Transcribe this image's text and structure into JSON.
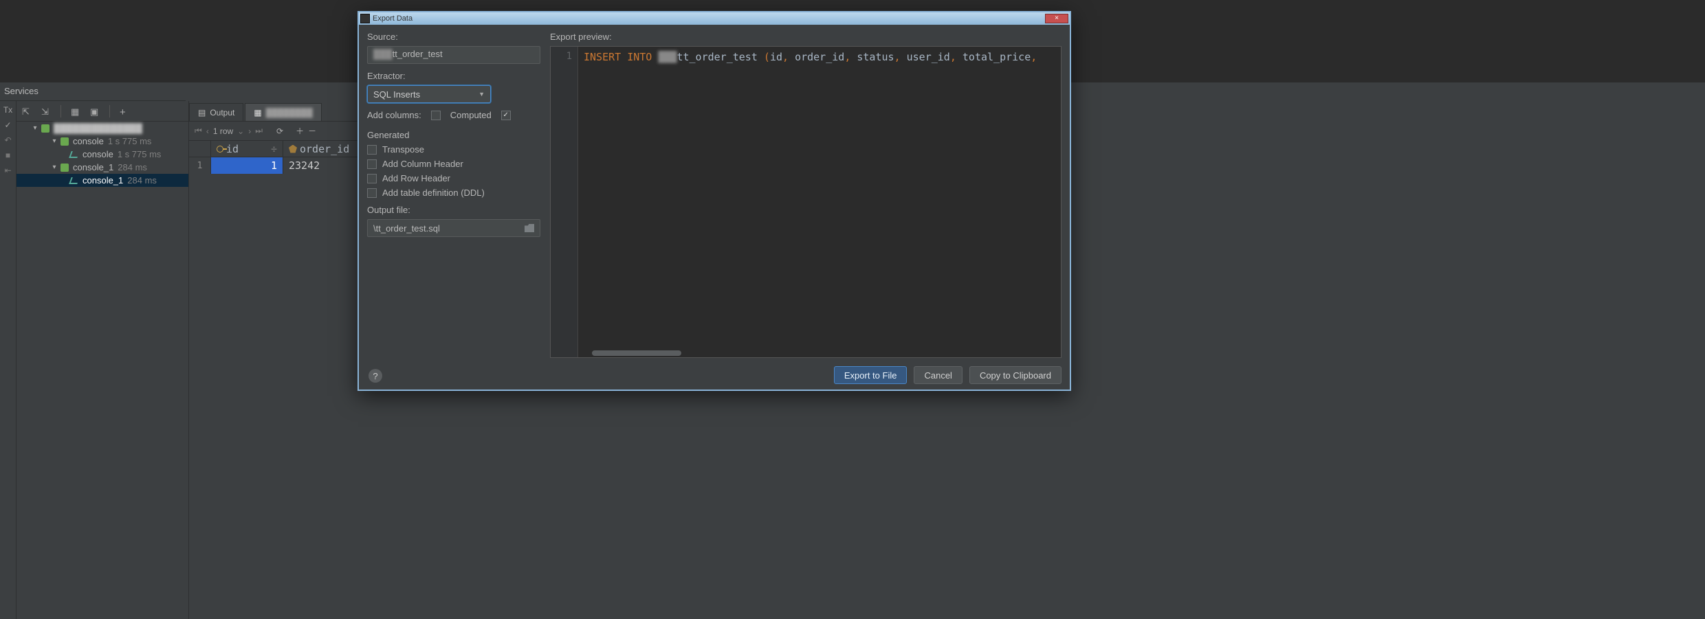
{
  "services": {
    "panel_title": "Services",
    "gutter": {
      "tx": "Tx"
    },
    "tree": {
      "root_label": "",
      "items": [
        {
          "label": "console",
          "time": "1 s 775 ms",
          "depth": 2
        },
        {
          "label": "console",
          "time": "1 s 775 ms",
          "depth": 3
        },
        {
          "label": "console_1",
          "time": "284 ms",
          "depth": 2
        },
        {
          "label": "console_1",
          "time": "284 ms",
          "depth": 3,
          "selected": true
        }
      ]
    }
  },
  "datapane": {
    "tab_output": "Output",
    "tab_table": "",
    "rowcount": "1 row",
    "columns": {
      "c1": "id",
      "c2": "order_id",
      "sort": "÷"
    },
    "rows": [
      {
        "num": "1",
        "c1": "1",
        "c2": "23242"
      }
    ]
  },
  "dialog": {
    "title": "Export Data",
    "source_label": "Source:",
    "source_value": "tt_order_test",
    "extractor_label": "Extractor:",
    "extractor_value": "SQL Inserts",
    "addcols_label": "Add columns:",
    "computed_label": "Computed",
    "generated_label": "Generated",
    "transpose_label": "Transpose",
    "addcolheader_label": "Add Column Header",
    "addrowheader_label": "Add Row Header",
    "addddl_label": "Add table definition (DDL)",
    "outputfile_label": "Output file:",
    "outputfile_value": "\\tt_order_test.sql",
    "preview_label": "Export preview:",
    "preview_lineno": "1",
    "sql": {
      "insert": "INSERT",
      "into": "INTO",
      "table": "tt_order_test",
      "c1": "id",
      "c2": "order_id",
      "c3": "status",
      "c4": "user_id",
      "c5": "total_price"
    },
    "help": "?",
    "btn_primary": "Export to File",
    "btn_cancel": "Cancel",
    "btn_copy": "Copy to Clipboard",
    "close_x": "×"
  }
}
